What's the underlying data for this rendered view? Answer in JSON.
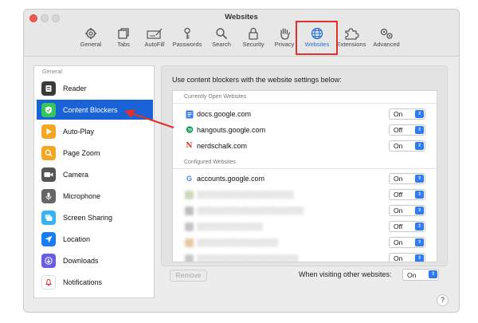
{
  "window": {
    "title": "Websites",
    "tabs": [
      {
        "label": "General",
        "icon": "gear-icon"
      },
      {
        "label": "Tabs",
        "icon": "tabs-icon"
      },
      {
        "label": "AutoFill",
        "icon": "autofill-icon"
      },
      {
        "label": "Passwords",
        "icon": "key-icon"
      },
      {
        "label": "Search",
        "icon": "search-icon"
      },
      {
        "label": "Security",
        "icon": "lock-icon"
      },
      {
        "label": "Privacy",
        "icon": "hand-icon"
      },
      {
        "label": "Websites",
        "icon": "globe-icon",
        "active": true
      },
      {
        "label": "Extensions",
        "icon": "puzzle-icon"
      },
      {
        "label": "Advanced",
        "icon": "gears-icon"
      }
    ]
  },
  "sidebar": {
    "section": "General",
    "items": [
      {
        "label": "Reader",
        "icon": "reader-icon",
        "color": "#3a3a3a"
      },
      {
        "label": "Content Blockers",
        "icon": "shield-check-icon",
        "color": "#34c759",
        "selected": true
      },
      {
        "label": "Auto-Play",
        "icon": "play-icon",
        "color": "#f5a623"
      },
      {
        "label": "Page Zoom",
        "icon": "zoom-icon",
        "color": "#f5a623"
      },
      {
        "label": "Camera",
        "icon": "camera-icon",
        "color": "#555555"
      },
      {
        "label": "Microphone",
        "icon": "microphone-icon",
        "color": "#666666"
      },
      {
        "label": "Screen Sharing",
        "icon": "screen-share-icon",
        "color": "#36b3f0"
      },
      {
        "label": "Location",
        "icon": "location-icon",
        "color": "#1a7cf5"
      },
      {
        "label": "Downloads",
        "icon": "download-icon",
        "color": "#6a5ce6"
      },
      {
        "label": "Notifications",
        "icon": "bell-icon",
        "color": "#ffffff"
      }
    ]
  },
  "main": {
    "caption": "Use content blockers with the website settings below:",
    "open_header": "Currently Open Websites",
    "open_sites": [
      {
        "domain": "docs.google.com",
        "value": "On",
        "icon": "docs-favicon-icon"
      },
      {
        "domain": "hangouts.google.com",
        "value": "Off",
        "icon": "hangouts-favicon-icon"
      },
      {
        "domain": "nerdschalk.com",
        "value": "On",
        "icon": "nerdschalk-favicon-icon"
      }
    ],
    "configured_header": "Configured Websites",
    "configured_sites": [
      {
        "domain": "accounts.google.com",
        "value": "On",
        "icon": "google-favicon-icon",
        "blurred": false
      },
      {
        "domain": "░░░░░░░░░░░░░░░░░░░",
        "value": "Off",
        "blurred": true
      },
      {
        "domain": "░░░░░░░░░░░░░░░░░░░░░",
        "value": "On",
        "blurred": true
      },
      {
        "domain": "░░░░░░░░░░░░░",
        "value": "Off",
        "blurred": true
      },
      {
        "domain": "░░░░░░░░░░░░░░░░",
        "value": "On",
        "blurred": true
      },
      {
        "domain": "░░░░░░░░░░░░░░░░░░░░",
        "value": "On",
        "blurred": true
      }
    ],
    "remove_label": "Remove",
    "other_label": "When visiting other websites:",
    "other_value": "On"
  },
  "help_label": "?",
  "colors": {
    "accent": "#1a63d6",
    "annotation_red": "#e0312b"
  }
}
